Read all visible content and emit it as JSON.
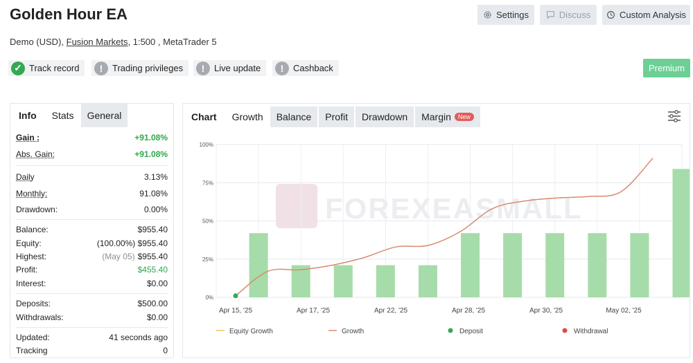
{
  "header": {
    "title": "Golden Hour EA",
    "account_type": "Demo (USD),",
    "broker": "Fusion Markets",
    "leverage_platform": ", 1:500 , MetaTrader 5",
    "buttons": {
      "settings": "Settings",
      "discuss": "Discuss",
      "custom_analysis": "Custom Analysis"
    },
    "badges": [
      {
        "label": "Track record",
        "status": "verified",
        "icon": "check-icon"
      },
      {
        "label": "Trading privileges",
        "status": "unverified",
        "icon": "exclamation-icon"
      },
      {
        "label": "Live update",
        "status": "unverified",
        "icon": "exclamation-icon"
      },
      {
        "label": "Cashback",
        "status": "unverified",
        "icon": "exclamation-icon"
      }
    ],
    "premium_label": "Premium"
  },
  "left_panel": {
    "tabs": [
      "Info",
      "Stats",
      "General"
    ],
    "stats": {
      "gain_label": "Gain :",
      "gain": "+91.08%",
      "abs_gain_label": "Abs. Gain:",
      "abs_gain": "+91.08%",
      "daily_label": "Daily",
      "daily": "3.13%",
      "monthly_label": "Monthly:",
      "monthly": "91.08%",
      "drawdown_label": "Drawdown:",
      "drawdown": "0.00%",
      "balance_label": "Balance:",
      "balance": "$955.40",
      "equity_label": "Equity:",
      "equity_pct": "(100.00%)",
      "equity": "$955.40",
      "highest_label": "Highest:",
      "highest_date": "(May 05)",
      "highest": "$955.40",
      "profit_label": "Profit:",
      "profit": "$455.40",
      "interest_label": "Interest:",
      "interest": "$0.00",
      "deposits_label": "Deposits:",
      "deposits": "$500.00",
      "withdrawals_label": "Withdrawals:",
      "withdrawals": "$0.00",
      "updated_label": "Updated:",
      "updated": "41 seconds ago",
      "tracking_label": "Tracking",
      "tracking": "0"
    }
  },
  "right_panel": {
    "tabs": [
      "Chart",
      "Growth",
      "Balance",
      "Profit",
      "Drawdown",
      "Margin"
    ],
    "new_tag": "New",
    "watermark": "FOREXEASMALL"
  },
  "chart_data": {
    "type": "bar",
    "y_ticks": [
      "0%",
      "25%",
      "50%",
      "75%",
      "100%"
    ],
    "ylim": [
      0,
      100
    ],
    "x_tick_labels": [
      "Apr 15, '25",
      "Apr 17, '25",
      "Apr 22, '25",
      "Apr 28, '25",
      "Apr 30, '25",
      "May 02, '25"
    ],
    "bars": [
      42,
      21,
      21,
      21,
      21,
      42,
      42,
      42,
      42,
      42,
      84
    ],
    "growth_line": [
      1,
      17,
      18,
      21,
      26,
      33,
      34,
      43,
      58,
      63,
      65,
      66,
      69,
      91
    ],
    "deposit_point": 0,
    "legend": [
      "Equity Growth",
      "Growth",
      "Deposit",
      "Withdrawal"
    ],
    "colors": {
      "bar": "#a6dca9",
      "growth": "#d88a6c",
      "equity": "#f0c455",
      "deposit": "#34a853",
      "withdrawal": "#e04a4a"
    }
  }
}
